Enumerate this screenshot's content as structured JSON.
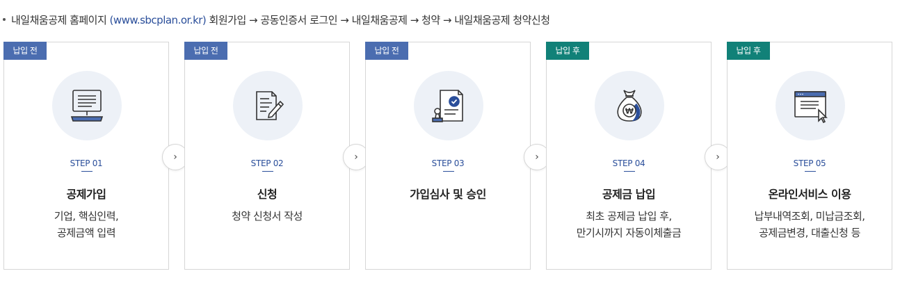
{
  "intro": {
    "prefix": "내일채움공제 홈페이지 ",
    "url": "(www.sbcplan.or.kr)",
    "suffix": " 회원가입 → 공동인증서 로그인 → 내일채움공제 → 청약 → 내일채움공제 청약신청"
  },
  "arrow_glyph": "›",
  "colors": {
    "before_badge": "#4b6db0",
    "after_badge": "#118178",
    "step_text": "#2a4e9a",
    "icon_circle": "#edf1f7"
  },
  "steps": [
    {
      "badge": "납입 전",
      "step": "STEP 01",
      "title": "공제가입",
      "desc1": "기업, 핵심인력,",
      "desc2": "공제금액 입력",
      "icon": "computer-icon"
    },
    {
      "badge": "납입 전",
      "step": "STEP 02",
      "title": "신청",
      "desc1": "청약 신청서 작성",
      "desc2": "",
      "icon": "document-pen-icon"
    },
    {
      "badge": "납입 전",
      "step": "STEP 03",
      "title": "가입심사 및 승인",
      "desc1": "",
      "desc2": "",
      "icon": "stamp-approval-icon"
    },
    {
      "badge": "납입 후",
      "step": "STEP 04",
      "title": "공제금 납입",
      "desc1": "최초 공제금 납입 후,",
      "desc2": "만기시까지 자동이체출금",
      "icon": "money-bag-icon"
    },
    {
      "badge": "납입 후",
      "step": "STEP 05",
      "title": "온라인서비스 이용",
      "desc1": "납부내역조회, 미납금조회,",
      "desc2": "공제금변경, 대출신청 등",
      "icon": "browser-window-icon"
    }
  ]
}
